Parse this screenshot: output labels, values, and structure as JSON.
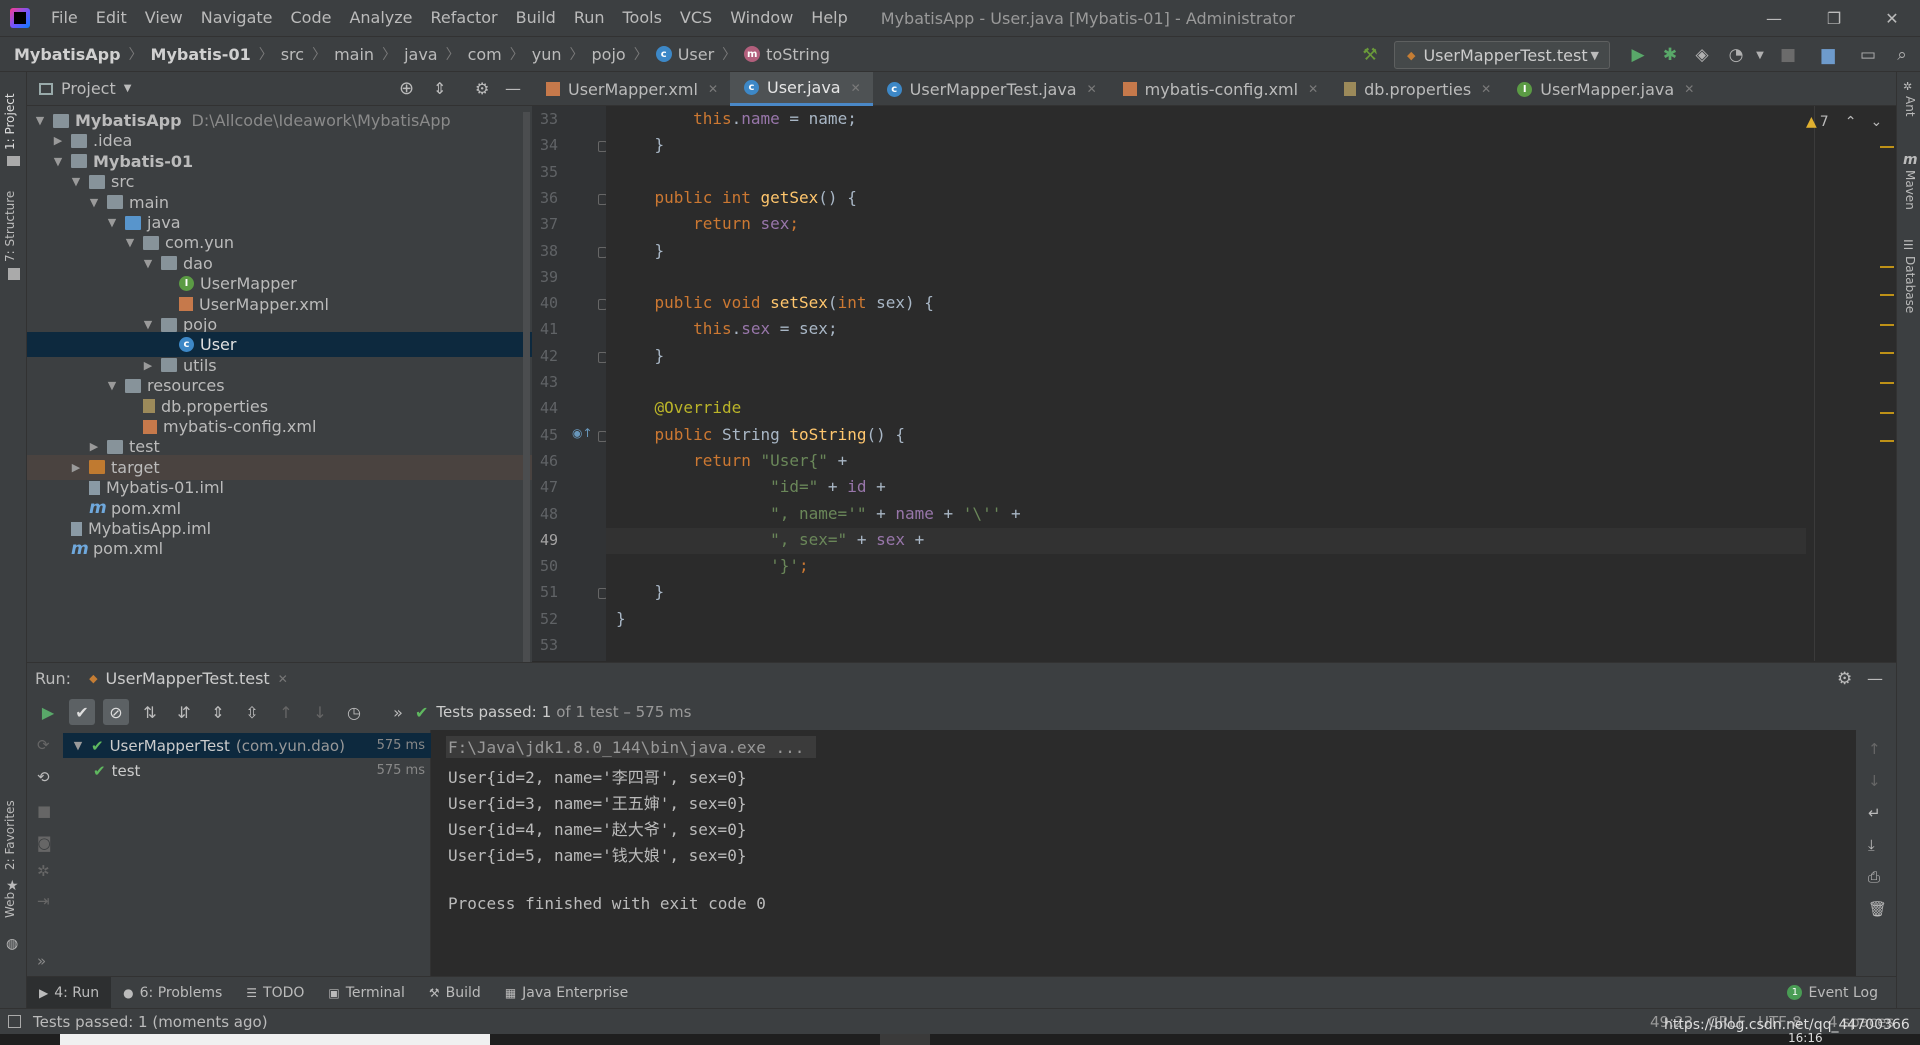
{
  "menubar": {
    "items": [
      "File",
      "Edit",
      "View",
      "Navigate",
      "Code",
      "Analyze",
      "Refactor",
      "Build",
      "Run",
      "Tools",
      "VCS",
      "Window",
      "Help"
    ],
    "title": "MybatisApp - User.java [Mybatis-01] - Administrator"
  },
  "navbar": {
    "crumbs": [
      "MybatisApp",
      "Mybatis-01",
      "src",
      "main",
      "java",
      "com",
      "yun",
      "pojo",
      "User",
      "toString"
    ],
    "run_config": "UserMapperTest.test"
  },
  "left_strip": {
    "tabs": [
      "1: Project",
      "7: Structure",
      "2: Favorites",
      "Web"
    ]
  },
  "right_strip": {
    "tabs": [
      "Ant",
      "Maven",
      "Database"
    ]
  },
  "project": {
    "header": "Project",
    "tree": [
      {
        "label": "MybatisApp",
        "note": "D:\\Allcode\\Ideawork\\MybatisApp",
        "depth": 0,
        "arrow": "down",
        "icon": "folder-mod",
        "bold": true
      },
      {
        "label": ".idea",
        "depth": 1,
        "arrow": "right",
        "icon": "folder"
      },
      {
        "label": "Mybatis-01",
        "depth": 1,
        "arrow": "down",
        "icon": "folder-mod",
        "bold": true
      },
      {
        "label": "src",
        "depth": 2,
        "arrow": "down",
        "icon": "folder"
      },
      {
        "label": "main",
        "depth": 3,
        "arrow": "down",
        "icon": "folder"
      },
      {
        "label": "java",
        "depth": 4,
        "arrow": "down",
        "icon": "folder-blue"
      },
      {
        "label": "com.yun",
        "depth": 5,
        "arrow": "down",
        "icon": "folder"
      },
      {
        "label": "dao",
        "depth": 6,
        "arrow": "down",
        "icon": "folder"
      },
      {
        "label": "UserMapper",
        "depth": 7,
        "arrow": "none",
        "icon": "interface"
      },
      {
        "label": "UserMapper.xml",
        "depth": 7,
        "arrow": "none",
        "icon": "xml"
      },
      {
        "label": "pojo",
        "depth": 6,
        "arrow": "down",
        "icon": "folder"
      },
      {
        "label": "User",
        "depth": 7,
        "arrow": "none",
        "icon": "class",
        "selected": true
      },
      {
        "label": "utils",
        "depth": 6,
        "arrow": "right",
        "icon": "folder"
      },
      {
        "label": "resources",
        "depth": 4,
        "arrow": "down",
        "icon": "folder"
      },
      {
        "label": "db.properties",
        "depth": 5,
        "arrow": "none",
        "icon": "props"
      },
      {
        "label": "mybatis-config.xml",
        "depth": 5,
        "arrow": "none",
        "icon": "xml"
      },
      {
        "label": "test",
        "depth": 3,
        "arrow": "right",
        "icon": "folder"
      },
      {
        "label": "target",
        "depth": 2,
        "arrow": "right",
        "icon": "folder-orange",
        "target": true
      },
      {
        "label": "Mybatis-01.iml",
        "depth": 2,
        "arrow": "none",
        "icon": "iml"
      },
      {
        "label": "pom.xml",
        "depth": 2,
        "arrow": "none",
        "icon": "maven"
      },
      {
        "label": "MybatisApp.iml",
        "depth": 1,
        "arrow": "none",
        "icon": "iml"
      },
      {
        "label": "pom.xml",
        "depth": 1,
        "arrow": "none",
        "icon": "maven"
      }
    ]
  },
  "editor": {
    "tabs": [
      {
        "label": "UserMapper.xml",
        "icon": "xml"
      },
      {
        "label": "User.java",
        "icon": "class",
        "active": true
      },
      {
        "label": "UserMapperTest.java",
        "icon": "class"
      },
      {
        "label": "mybatis-config.xml",
        "icon": "xml"
      },
      {
        "label": "db.properties",
        "icon": "props"
      },
      {
        "label": "UserMapper.java",
        "icon": "interface"
      }
    ],
    "warnings": "7",
    "line_numbers": [
      "33",
      "34",
      "35",
      "36",
      "37",
      "38",
      "39",
      "40",
      "41",
      "42",
      "43",
      "44",
      "45",
      "46",
      "47",
      "48",
      "49",
      "50",
      "51",
      "52",
      "53"
    ],
    "current_line": "49",
    "code": [
      [
        [
          "        ",
          "def"
        ],
        [
          "this",
          "kw"
        ],
        [
          ".",
          "def"
        ],
        [
          "name",
          "fld"
        ],
        [
          " = name;",
          "def"
        ]
      ],
      [
        [
          "    }",
          "def"
        ]
      ],
      [
        [
          "",
          ""
        ]
      ],
      [
        [
          "    ",
          "def"
        ],
        [
          "public int ",
          "kw"
        ],
        [
          "getSex",
          "fn"
        ],
        [
          "() {",
          "def"
        ]
      ],
      [
        [
          "        ",
          "def"
        ],
        [
          "return ",
          "kw"
        ],
        [
          "sex",
          "fld"
        ],
        [
          ";",
          "kw"
        ]
      ],
      [
        [
          "    }",
          "def"
        ]
      ],
      [
        [
          "",
          ""
        ]
      ],
      [
        [
          "    ",
          "def"
        ],
        [
          "public void ",
          "kw"
        ],
        [
          "setSex",
          "fn"
        ],
        [
          "(",
          "def"
        ],
        [
          "int ",
          "kw"
        ],
        [
          "sex) {",
          "def"
        ]
      ],
      [
        [
          "        ",
          "def"
        ],
        [
          "this",
          "kw"
        ],
        [
          ".",
          "def"
        ],
        [
          "sex",
          "fld"
        ],
        [
          " = sex;",
          "def"
        ]
      ],
      [
        [
          "    }",
          "def"
        ]
      ],
      [
        [
          "",
          ""
        ]
      ],
      [
        [
          "    ",
          "def"
        ],
        [
          "@Override",
          "ann"
        ]
      ],
      [
        [
          "    ",
          "def"
        ],
        [
          "public ",
          "kw"
        ],
        [
          "String ",
          "def"
        ],
        [
          "toString",
          "fn"
        ],
        [
          "() {",
          "def"
        ]
      ],
      [
        [
          "        ",
          "def"
        ],
        [
          "return ",
          "kw"
        ],
        [
          "\"User{\"",
          "str"
        ],
        [
          " +",
          "def"
        ]
      ],
      [
        [
          "                ",
          "def"
        ],
        [
          "\"id=\"",
          "str"
        ],
        [
          " + ",
          "def"
        ],
        [
          "id",
          "fld"
        ],
        [
          " +",
          "def"
        ]
      ],
      [
        [
          "                ",
          "def"
        ],
        [
          "\", name='\"",
          "str"
        ],
        [
          " + ",
          "def"
        ],
        [
          "name",
          "fld"
        ],
        [
          " + ",
          "def"
        ],
        [
          "'\\''",
          "str"
        ],
        [
          " +",
          "def"
        ]
      ],
      [
        [
          "                ",
          "def"
        ],
        [
          "\", sex=\"",
          "str"
        ],
        [
          " + ",
          "def"
        ],
        [
          "sex",
          "fld"
        ],
        [
          " +",
          "def"
        ]
      ],
      [
        [
          "                ",
          "def"
        ],
        [
          "'}'",
          "str"
        ],
        [
          ";",
          "kw"
        ]
      ],
      [
        [
          "    }",
          "def"
        ]
      ],
      [
        [
          "}",
          "def"
        ]
      ],
      [
        [
          "",
          ""
        ]
      ]
    ]
  },
  "run": {
    "label": "Run:",
    "tab": "UserMapperTest.test",
    "status_prefix": "Tests passed:",
    "status_count": "1",
    "status_suffix": "of 1 test – 575 ms",
    "tests": [
      {
        "label": "UserMapperTest",
        "pkg": "(com.yun.dao)",
        "ms": "575 ms",
        "depth": 0
      },
      {
        "label": "test",
        "pkg": "",
        "ms": "575 ms",
        "depth": 1
      }
    ],
    "console": [
      "F:\\Java\\jdk1.8.0_144\\bin\\java.exe ...",
      "User{id=2, name='李四哥', sex=0}",
      "User{id=3, name='王五婶', sex=0}",
      "User{id=4, name='赵大爷', sex=0}",
      "User{id=5, name='钱大娘', sex=0}",
      "",
      "Process finished with exit code 0"
    ]
  },
  "toolwindows": [
    {
      "label": "4: Run",
      "active": true,
      "icon": "▶"
    },
    {
      "label": "6: Problems",
      "icon": "●"
    },
    {
      "label": "TODO",
      "icon": "☰"
    },
    {
      "label": "Terminal",
      "icon": "▣"
    },
    {
      "label": "Build",
      "icon": "⚒"
    },
    {
      "label": "Java Enterprise",
      "icon": "▦"
    }
  ],
  "event_log": "Event Log",
  "event_log_count": "1",
  "status": {
    "message": "Tests passed: 1 (moments ago)",
    "position": "49:23",
    "line_sep": "CRLF",
    "encoding": "UTF-8",
    "indent": "4 spaces",
    "watermark": "https://blog.csdn.net/qq_44700366",
    "clock": "16:16"
  },
  "colors": {
    "accent": "#4a88c7",
    "selection": "#0d293e",
    "pass": "#5fb85f"
  }
}
